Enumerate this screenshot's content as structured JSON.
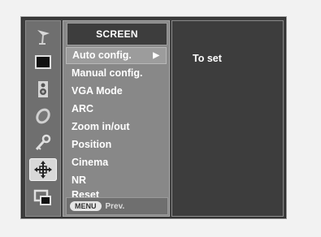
{
  "menu": {
    "title": "SCREEN",
    "items": [
      {
        "label": "Auto config.",
        "selected": true,
        "arrow": "▶"
      },
      {
        "label": "Manual config."
      },
      {
        "label": "VGA Mode"
      },
      {
        "label": "ARC"
      },
      {
        "label": "Zoom in/out"
      },
      {
        "label": "Position"
      },
      {
        "label": "Cinema"
      },
      {
        "label": "NR"
      },
      {
        "label": "Reset"
      }
    ],
    "footer": {
      "menu_button": "MENU",
      "prev_label": "Prev."
    }
  },
  "submenu": {
    "item": "To set"
  },
  "rail_icons": [
    {
      "name": "antenna-icon"
    },
    {
      "name": "picture-icon"
    },
    {
      "name": "speaker-icon"
    },
    {
      "name": "clock-icon"
    },
    {
      "name": "key-icon"
    },
    {
      "name": "screen-arrows-icon",
      "selected": true
    },
    {
      "name": "pip-icon"
    }
  ],
  "colors": {
    "osd_bg": "#3d3d3d",
    "panel_bg": "#888888",
    "rail_bg": "#6f6f6f",
    "selected_bg": "#d8d8d8"
  }
}
